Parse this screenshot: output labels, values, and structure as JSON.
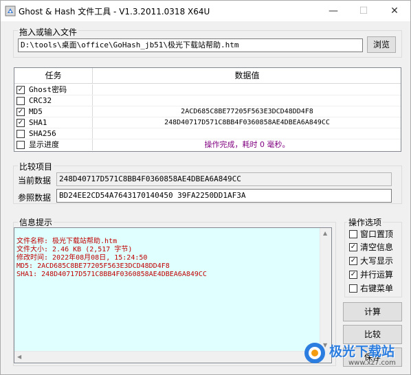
{
  "window": {
    "title": "Ghost & Hash 文件工具 - V1.3.2011.0318 X64U",
    "minimize_glyph": "—",
    "maximize_glyph": "☐",
    "close_glyph": "✕"
  },
  "file_section": {
    "label": "拖入或输入文件",
    "path_value": "D:\\tools\\桌面\\office\\GoHash_jb51\\极光下载站帮助.htm",
    "browse_label": "浏览"
  },
  "grid": {
    "col_task": "任务",
    "col_value": "数据值",
    "rows": [
      {
        "name": "Ghost密码",
        "checked": true,
        "mark": "✓",
        "value": "",
        "status": false
      },
      {
        "name": "CRC32",
        "checked": false,
        "mark": "",
        "value": "",
        "status": false
      },
      {
        "name": "MD5",
        "checked": true,
        "mark": "✓",
        "value": "2ACD685C8BE77205F563E3DCD48DD4F8",
        "status": false
      },
      {
        "name": "SHA1",
        "checked": true,
        "mark": "✓",
        "value": "248D40717D571C8BB4F0360858AE4DBEA6A849CC",
        "status": false
      },
      {
        "name": "SHA256",
        "checked": false,
        "mark": "",
        "value": "",
        "status": false
      },
      {
        "name": "显示进度",
        "checked": false,
        "mark": "",
        "value": "操作完成，耗时 0 毫秒。",
        "status": true
      }
    ],
    "status_color": "#800080"
  },
  "compare": {
    "group_label": "比较项目",
    "current_label": "当前数据",
    "current_value": "248D40717D571C8BB4F0360858AE4DBEA6A849CC",
    "reference_label": "参照数据",
    "reference_value": "BD24EE2CD54A7643170140450 39FA2250DD1AF3A"
  },
  "info": {
    "group_label": "信息提示",
    "lines": [
      "文件名称: 极光下载站帮助.htm",
      "文件大小: 2.46 KB (2,517 字节)",
      "修改时间: 2022年08月08日, 15:24:50",
      "MD5: 2ACD685C8BE77205F563E3DCD48DD4F8",
      "SHA1: 248D40717D571C8BB4F0360858AE4DBEA6A849CC"
    ],
    "text_color": "#c00000",
    "background": "#e0ffff"
  },
  "options": {
    "group_label": "操作选项",
    "items": [
      {
        "label": "窗口置顶",
        "checked": false,
        "mark": ""
      },
      {
        "label": "清空信息",
        "checked": true,
        "mark": "✓"
      },
      {
        "label": "大写显示",
        "checked": true,
        "mark": "✓"
      },
      {
        "label": "并行运算",
        "checked": true,
        "mark": "✓"
      },
      {
        "label": "右键菜单",
        "checked": false,
        "mark": ""
      }
    ]
  },
  "actions": {
    "calculate_label": "计算",
    "compare_label": "比较",
    "save_label": "保存"
  },
  "watermark": {
    "brand_text": "极光下载站",
    "url_text": "www.xz7.com"
  }
}
